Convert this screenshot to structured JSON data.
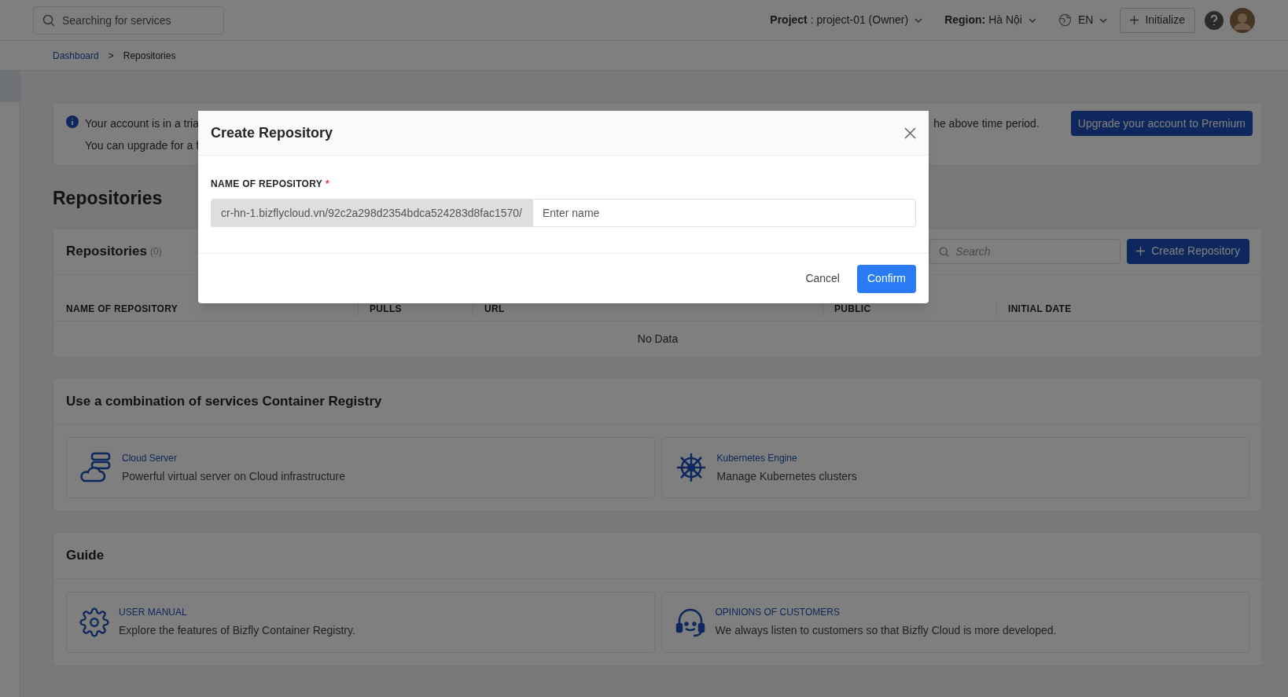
{
  "topbar": {
    "search_placeholder": "Searching for services",
    "project_label": "Project",
    "project_value": ": project-01 (Owner)",
    "region_label": "Region:",
    "region_value": "Hà Nội",
    "language": "EN",
    "initialize_button": "Initialize"
  },
  "breadcrumb": {
    "items": [
      "Dashboard",
      "Repositories"
    ],
    "separator": ">"
  },
  "banner": {
    "line1_start": "Your account is in a tria",
    "line1_end": "he above time period.",
    "line2_start": "You can upgrade for a f",
    "upgrade_button": "Upgrade your account to Premium"
  },
  "page_title": "Repositories",
  "table": {
    "title": "Repositories",
    "count": "(0)",
    "search_placeholder": "Search",
    "create_button": "Create Repository",
    "columns": [
      "NAME OF REPOSITORY",
      "PULLS",
      "URL",
      "PUBLIC",
      "INITIAL DATE"
    ],
    "empty": "No Data"
  },
  "combination": {
    "title": "Use a combination of services Container Registry",
    "items": [
      {
        "kind": "server",
        "title": "Cloud Server",
        "description": "Powerful virtual server on Cloud infrastructure"
      },
      {
        "kind": "kubernetes",
        "title": "Kubernetes Engine",
        "description": "Manage Kubernetes clusters"
      }
    ]
  },
  "guide": {
    "title": "Guide",
    "items": [
      {
        "kind": "manual",
        "title": "USER MANUAL",
        "description": "Explore the features of Bizfly Container Registry."
      },
      {
        "kind": "support",
        "title": "OPINIONS OF CUSTOMERS",
        "description": "We always listen to customers so that Bizfly Cloud is more developed."
      }
    ]
  },
  "modal": {
    "title": "Create Repository",
    "field_label": "NAME OF REPOSITORY",
    "required_mark": "*",
    "prefix": "cr-hn-1.bizflycloud.vn/92c2a298d2354bdca524283d8fac1570/",
    "placeholder": "Enter name",
    "cancel_button": "Cancel",
    "confirm_button": "Confirm"
  }
}
